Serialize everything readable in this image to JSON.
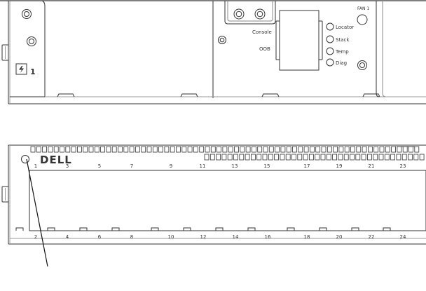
{
  "rear_panel": {
    "psu_number": "1",
    "console_label": "Console",
    "oob_label": "OOB",
    "fan_label": "FAN 1",
    "leds": [
      "Locator",
      "Stack",
      "Temp",
      "Diag"
    ]
  },
  "front_panel": {
    "logo": "DELL",
    "top_port_numbers": [
      "1",
      "3",
      "5",
      "7",
      "9",
      "11",
      "13",
      "15",
      "17",
      "19",
      "21",
      "23"
    ],
    "bottom_port_numbers": [
      "2",
      "4",
      "6",
      "8",
      "10",
      "12",
      "14",
      "16",
      "18",
      "20",
      "22",
      "24"
    ]
  },
  "icons": {
    "psu_power": "lightning-bolt-icon",
    "screw": "screw-hole-icon",
    "led": "status-led-icon"
  }
}
